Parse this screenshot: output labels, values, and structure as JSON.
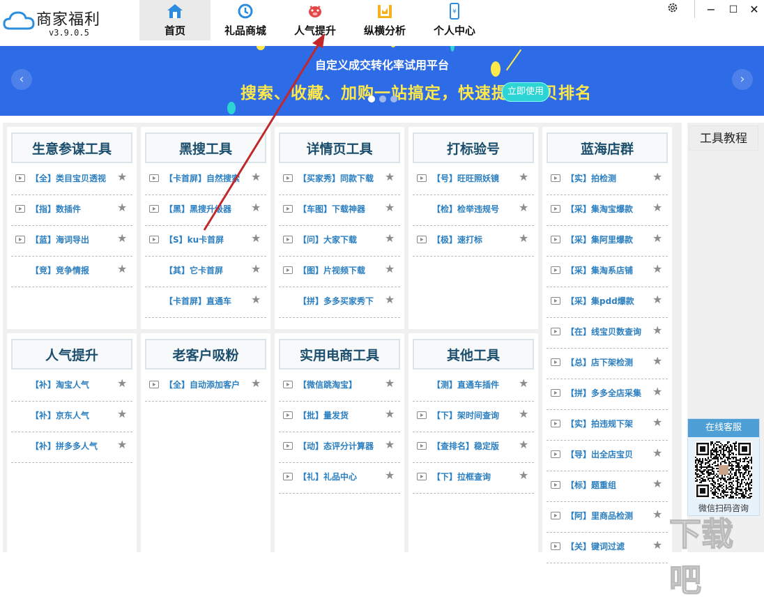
{
  "app": {
    "title": "商家福利",
    "version": "v3.9.0.5"
  },
  "nav": [
    {
      "label": "首页",
      "icon": "home-icon",
      "active": true
    },
    {
      "label": "礼品商城",
      "icon": "gift-ring-icon",
      "active": false
    },
    {
      "label": "人气提升",
      "icon": "pig-icon",
      "active": false
    },
    {
      "label": "纵横分析",
      "icon": "crown-chart-icon",
      "active": false
    },
    {
      "label": "个人中心",
      "icon": "phone-yuan-icon",
      "active": false
    }
  ],
  "window": {
    "settings_icon": "gear-icon",
    "minimize": "−",
    "maximize": "☐",
    "close": "✕"
  },
  "banner": {
    "subtitle": "自定义成交转化率试用平台",
    "headline": "搜索、收藏、加购一站搞定，快速提升宝贝排名",
    "button": "立即使用",
    "prev": "‹",
    "next": "›"
  },
  "sections": [
    {
      "title": "生意参谋工具",
      "items": [
        {
          "label": "【全】类目宝贝透视",
          "video": true
        },
        {
          "label": "【指】数插件",
          "video": true
        },
        {
          "label": "【蓝】海词导出",
          "video": true
        },
        {
          "label": "【竞】竞争情报",
          "video": false
        }
      ]
    },
    {
      "title": "黑搜工具",
      "items": [
        {
          "label": "【卡首屏】自然搜索",
          "video": true
        },
        {
          "label": "【黑】黑搜升级器",
          "video": true
        },
        {
          "label": "【S】ku卡首屏",
          "video": true
        },
        {
          "label": "【其】它卡首屏",
          "video": false
        },
        {
          "label": "【卡首屏】直通车",
          "video": false
        }
      ]
    },
    {
      "title": "详情页工具",
      "items": [
        {
          "label": "【买家秀】同款下载",
          "video": true
        },
        {
          "label": "【车图】下载神器",
          "video": true
        },
        {
          "label": "【问】大家下载",
          "video": true
        },
        {
          "label": "【图】片视频下载",
          "video": true
        },
        {
          "label": "【拼】多多买家秀下",
          "video": false
        }
      ]
    },
    {
      "title": "打标验号",
      "items": [
        {
          "label": "【号】旺旺照妖镜",
          "video": true
        },
        {
          "label": "【检】检举违规号",
          "video": false
        },
        {
          "label": "【极】速打标",
          "video": true
        }
      ]
    },
    {
      "title": "蓝海店群",
      "items": [
        {
          "label": "【实】拍检测",
          "video": true
        },
        {
          "label": "【采】集淘宝爆款",
          "video": true
        },
        {
          "label": "【采】集阿里爆款",
          "video": true
        },
        {
          "label": "【采】集淘系店铺",
          "video": true
        },
        {
          "label": "【采】集pdd爆款",
          "video": true
        },
        {
          "label": "【在】线宝贝数查询",
          "video": true
        },
        {
          "label": "【总】店下架检测",
          "video": true
        },
        {
          "label": "【拼】多多全店采集",
          "video": true
        },
        {
          "label": "【实】拍违规下架",
          "video": true
        },
        {
          "label": "【导】出全店宝贝",
          "video": true
        },
        {
          "label": "【标】题重组",
          "video": true
        },
        {
          "label": "【阿】里商品检测",
          "video": true
        },
        {
          "label": "【关】键词过滤",
          "video": true
        }
      ]
    },
    {
      "title": "人气提升",
      "items": [
        {
          "label": "【补】淘宝人气",
          "video": false
        },
        {
          "label": "【补】京东人气",
          "video": false
        },
        {
          "label": "【补】拼多多人气",
          "video": false
        }
      ]
    },
    {
      "title": "老客户吸粉",
      "items": [
        {
          "label": "【全】自动添加客户",
          "video": true
        }
      ]
    },
    {
      "title": "实用电商工具",
      "items": [
        {
          "label": "【微信跳淘宝】",
          "video": true
        },
        {
          "label": "【批】量发货",
          "video": true
        },
        {
          "label": "【动】态评分计算器",
          "video": true
        },
        {
          "label": "【礼】礼品中心",
          "video": true
        }
      ]
    },
    {
      "title": "其他工具",
      "items": [
        {
          "label": "【测】直通车插件",
          "video": false
        },
        {
          "label": "【下】架时间查询",
          "video": true
        },
        {
          "label": "【查排名】稳定版",
          "video": true
        },
        {
          "label": "【下】拉框查询",
          "video": true
        }
      ]
    }
  ],
  "sidebar": {
    "tutorial": "工具教程",
    "service_title": "在线客服",
    "service_caption": "微信扫码咨询"
  },
  "watermark": "下载吧",
  "colors": {
    "banner_bg": "#2e6be6",
    "headline": "#ffe84a",
    "tool_link": "#2c7fc0",
    "title_text": "#1b4e6c",
    "annotation_arrow": "#c0282c"
  }
}
